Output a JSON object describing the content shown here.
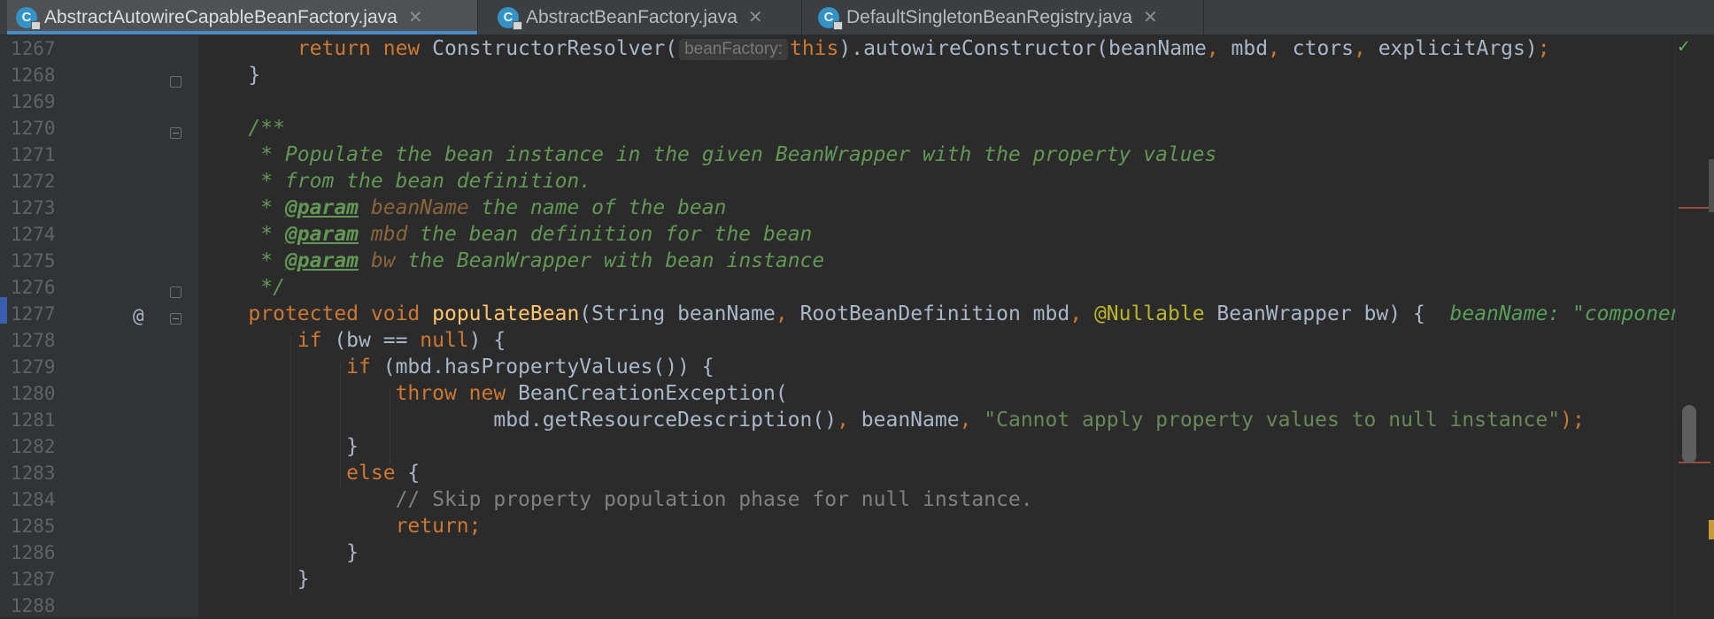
{
  "tabs": [
    {
      "label": "AbstractAutowireCapableBeanFactory.java",
      "icon": "class-icon",
      "active": true
    },
    {
      "label": "AbstractBeanFactory.java",
      "icon": "class-icon",
      "active": false
    },
    {
      "label": "DefaultSingletonBeanRegistry.java",
      "icon": "class-icon",
      "active": false
    }
  ],
  "tab_icon_letter": "C",
  "close_glyph": "✕",
  "inspection_status": "✓",
  "gutter": {
    "override_marker": "@"
  },
  "lines": [
    {
      "num": "1267"
    },
    {
      "num": "1268"
    },
    {
      "num": "1269"
    },
    {
      "num": "1270"
    },
    {
      "num": "1271"
    },
    {
      "num": "1272"
    },
    {
      "num": "1273"
    },
    {
      "num": "1274"
    },
    {
      "num": "1275"
    },
    {
      "num": "1276"
    },
    {
      "num": "1277"
    },
    {
      "num": "1278"
    },
    {
      "num": "1279"
    },
    {
      "num": "1280"
    },
    {
      "num": "1281"
    },
    {
      "num": "1282"
    },
    {
      "num": "1283"
    },
    {
      "num": "1284"
    },
    {
      "num": "1285"
    },
    {
      "num": "1286"
    },
    {
      "num": "1287"
    },
    {
      "num": "1288"
    }
  ],
  "code": {
    "l1267": {
      "kw1": "return",
      "kw2": "new",
      "cls": " ConstructorResolver(",
      "hint": "beanFactory:",
      "this": "this",
      "rest": ").autowireConstructor(beanName",
      "c1": ",",
      "a1": " mbd",
      "c2": ",",
      "a2": " ctors",
      "c3": ",",
      "a3": " explicitArgs)",
      "semi": ";"
    },
    "l1268": {
      "text": "}"
    },
    "l1270": {
      "text": "/**"
    },
    "l1271": {
      "text": " * Populate the bean instance in the given BeanWrapper with the property values"
    },
    "l1272": {
      "text": " * from the bean definition."
    },
    "l1273": {
      "star": " * ",
      "tag": "@param",
      "param": "beanName",
      "desc": " the name of the bean"
    },
    "l1274": {
      "star": " * ",
      "tag": "@param",
      "param": "mbd",
      "desc": " the bean definition for the bean"
    },
    "l1275": {
      "star": " * ",
      "tag": "@param",
      "param": "bw",
      "desc": " the BeanWrapper with bean instance"
    },
    "l1276": {
      "text": " */"
    },
    "l1277": {
      "kw1": "protected",
      "kw2": "void",
      "fn": "populateBean",
      "p1": "(String beanName",
      "c1": ",",
      "p2": " RootBeanDefinition mbd",
      "c2": ",",
      "ann": "@Nullable",
      "p3": " BeanWrapper bw) {",
      "inline": "beanName: \"component"
    },
    "l1278": {
      "kw": "if",
      "a": " (bw == ",
      "null": "null",
      "b": ") {"
    },
    "l1279": {
      "kw": "if",
      "a": " (mbd.hasPropertyValues()) {"
    },
    "l1280": {
      "kw1": "throw",
      "kw2": "new",
      "a": " BeanCreationException("
    },
    "l1281": {
      "a": "mbd.getResourceDescription()",
      "c1": ",",
      "b": " beanName",
      "c2": ",",
      "str": "\"Cannot apply property values to null instance\"",
      "end": ");"
    },
    "l1282": {
      "text": "}"
    },
    "l1283": {
      "kw": "else",
      "a": " {"
    },
    "l1284": {
      "text": "// Skip property population phase for null instance."
    },
    "l1285": {
      "kw": "return",
      "semi": ";"
    },
    "l1286": {
      "text": "}"
    },
    "l1287": {
      "text": "}"
    }
  }
}
